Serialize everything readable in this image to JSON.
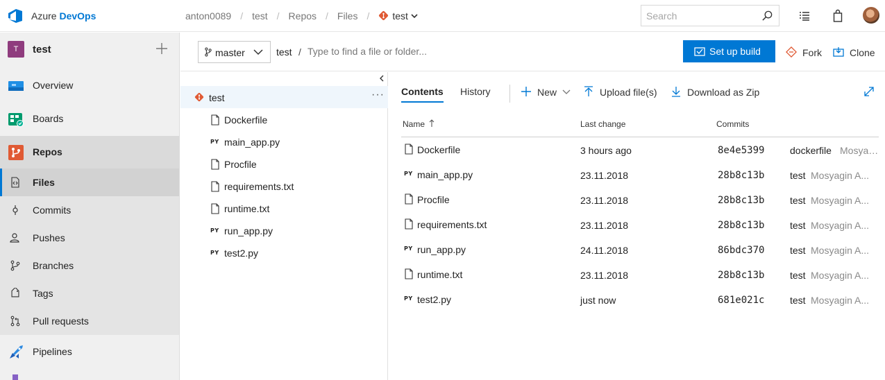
{
  "topbar": {
    "brand_prefix": "Azure",
    "brand_name": "DevOps",
    "breadcrumb": [
      "anton0089",
      "test",
      "Repos",
      "Files"
    ],
    "repo_name": "test",
    "search_placeholder": "Search"
  },
  "project": {
    "badge": "T",
    "name": "test"
  },
  "nav": {
    "overview": "Overview",
    "boards": "Boards",
    "repos": "Repos",
    "files": "Files",
    "commits": "Commits",
    "pushes": "Pushes",
    "branches": "Branches",
    "tags": "Tags",
    "pull_requests": "Pull requests",
    "pipelines": "Pipelines"
  },
  "repobar": {
    "branch": "master",
    "path_root": "test",
    "path_sep": "/",
    "path_placeholder": "Type to find a file or folder...",
    "setup_build": "Set up build",
    "fork": "Fork",
    "clone": "Clone"
  },
  "tree": {
    "root": "test",
    "more": "···",
    "items": [
      {
        "name": "Dockerfile",
        "type": "file"
      },
      {
        "name": "main_app.py",
        "type": "py"
      },
      {
        "name": "Procfile",
        "type": "file"
      },
      {
        "name": "requirements.txt",
        "type": "file"
      },
      {
        "name": "runtime.txt",
        "type": "file"
      },
      {
        "name": "run_app.py",
        "type": "py"
      },
      {
        "name": "test2.py",
        "type": "py"
      }
    ]
  },
  "content": {
    "tabs": [
      "Contents",
      "History"
    ],
    "new": "New",
    "upload": "Upload file(s)",
    "download": "Download as Zip",
    "py_label": "PY",
    "columns": {
      "name": "Name",
      "last_change": "Last change",
      "commits": "Commits"
    },
    "rows": [
      {
        "name": "Dockerfile",
        "type": "file",
        "last_change": "3 hours ago",
        "commit": "8e4e5399",
        "message": "dockerfile",
        "author": "Mosyagin A..."
      },
      {
        "name": "main_app.py",
        "type": "py",
        "last_change": "23.11.2018",
        "commit": "28b8c13b",
        "message": "test",
        "author": "Mosyagin A..."
      },
      {
        "name": "Procfile",
        "type": "file",
        "last_change": "23.11.2018",
        "commit": "28b8c13b",
        "message": "test",
        "author": "Mosyagin A..."
      },
      {
        "name": "requirements.txt",
        "type": "file",
        "last_change": "23.11.2018",
        "commit": "28b8c13b",
        "message": "test",
        "author": "Mosyagin A..."
      },
      {
        "name": "run_app.py",
        "type": "py",
        "last_change": "24.11.2018",
        "commit": "86bdc370",
        "message": "test",
        "author": "Mosyagin A..."
      },
      {
        "name": "runtime.txt",
        "type": "file",
        "last_change": "23.11.2018",
        "commit": "28b8c13b",
        "message": "test",
        "author": "Mosyagin A..."
      },
      {
        "name": "test2.py",
        "type": "py",
        "last_change": "just now",
        "commit": "681e021c",
        "message": "test",
        "author": "Mosyagin A..."
      }
    ]
  },
  "colors": {
    "accent": "#0078d4",
    "git": "#e05a34",
    "project_badge": "#8f3c7e"
  }
}
